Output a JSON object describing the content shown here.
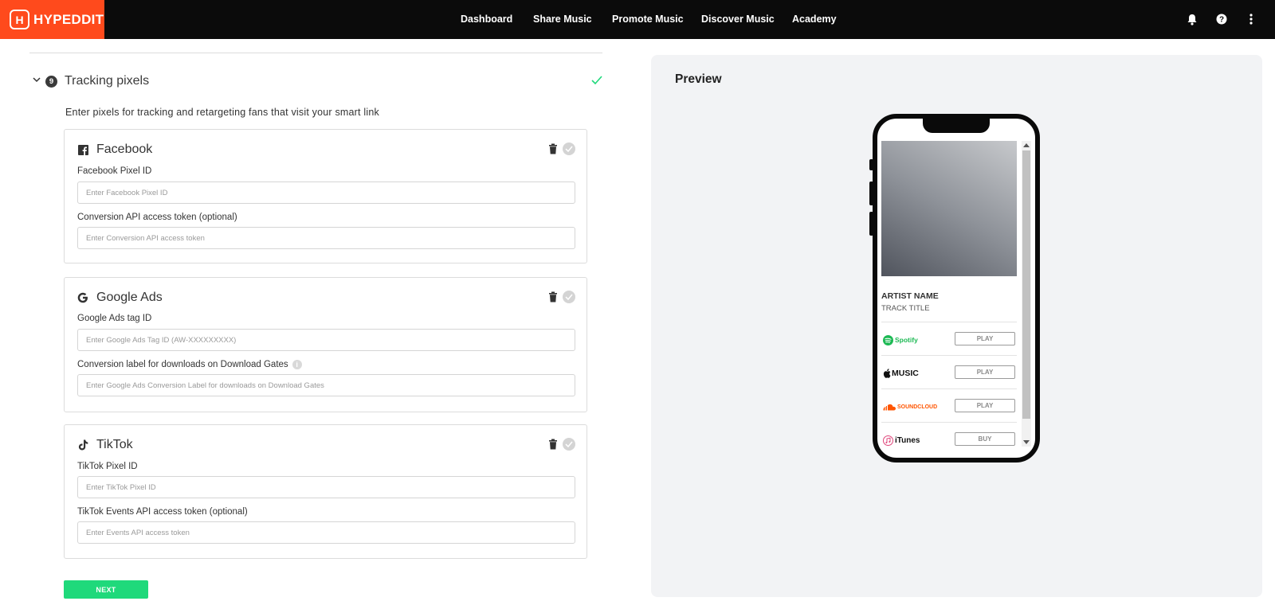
{
  "brand": {
    "name": "HYPEDDIT",
    "accent": "#ff4a1c"
  },
  "nav": {
    "links": [
      "Dashboard",
      "Share Music",
      "Promote Music",
      "Discover Music",
      "Academy"
    ],
    "icons": [
      "bell-icon",
      "help-icon",
      "more-vert-icon"
    ]
  },
  "section": {
    "step": "9",
    "title": "Tracking pixels",
    "description": "Enter pixels for tracking and retargeting fans that visit your smart link"
  },
  "cards": {
    "facebook": {
      "title": "Facebook",
      "field1_label": "Facebook Pixel ID",
      "field1_placeholder": "Enter Facebook Pixel ID",
      "field2_label": "Conversion API access token (optional)",
      "field2_placeholder": "Enter Conversion API access token"
    },
    "google": {
      "title": "Google Ads",
      "field1_label": "Google Ads tag ID",
      "field1_placeholder": "Enter Google Ads Tag ID (AW-XXXXXXXXX)",
      "field2_label": "Conversion label for downloads on Download Gates",
      "field2_placeholder": "Enter Google Ads Conversion Label for downloads on Download Gates"
    },
    "tiktok": {
      "title": "TikTok",
      "field1_label": "TikTok Pixel ID",
      "field1_placeholder": "Enter TikTok Pixel ID",
      "field2_label": "TikTok Events API access token (optional)",
      "field2_placeholder": "Enter Events API access token"
    }
  },
  "next_label": "NEXT",
  "preview": {
    "title": "Preview",
    "artist": "ARTIST NAME",
    "track": "TRACK TITLE",
    "services": [
      {
        "name": "Spotify",
        "action": "PLAY",
        "color": "#1db954"
      },
      {
        "name": "MUSIC",
        "action": "PLAY",
        "color": "#111111"
      },
      {
        "name": "SOUNDCLOUD",
        "action": "PLAY",
        "color": "#ff5500"
      },
      {
        "name": "iTunes",
        "action": "BUY",
        "color": "#111111"
      }
    ]
  }
}
